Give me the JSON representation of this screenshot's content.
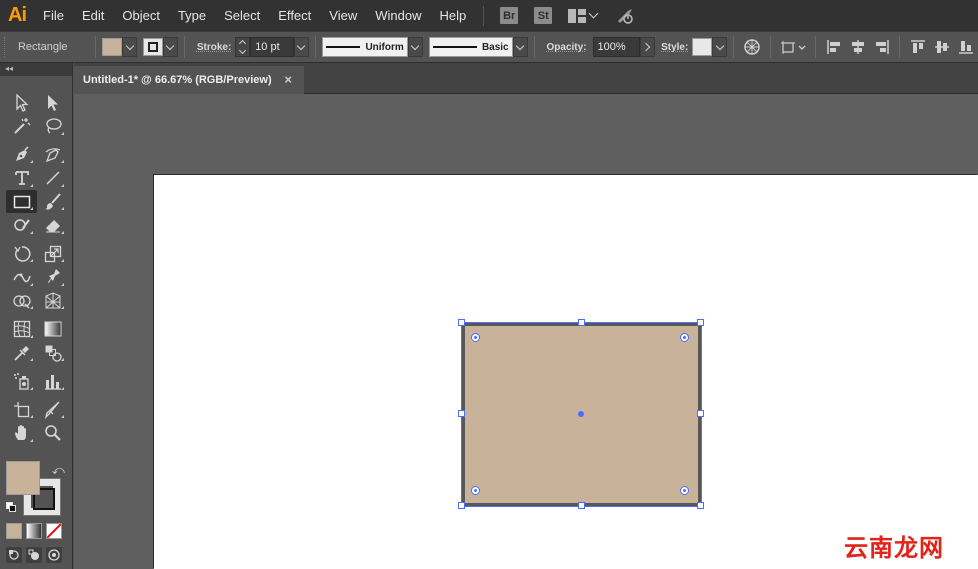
{
  "app": {
    "logo": "Ai",
    "accent": "#ff9a00"
  },
  "menu": {
    "items": [
      "File",
      "Edit",
      "Object",
      "Type",
      "Select",
      "Effect",
      "View",
      "Window",
      "Help"
    ],
    "bridge_label": "Br",
    "stock_label": "St",
    "workspace_icon": "workspace-grid-icon",
    "sync_icon": "gpu-rocket-icon"
  },
  "control": {
    "tool_name": "Rectangle",
    "fill_color": "#c8b29a",
    "stroke_label": "Stroke:",
    "stroke_weight": "10 pt",
    "variable_width_profile": "Uniform",
    "brush_definition": "Basic",
    "opacity_label": "Opacity:",
    "opacity_value": "100%",
    "style_label": "Style:"
  },
  "toolbar": {
    "collapse_label": "◂◂",
    "active_tool": "rectangle-tool",
    "fill_color": "#c8b29a",
    "stroke_color": "#e6e6e6"
  },
  "document": {
    "tab_title": "Untitled-1* @ 66.67% (RGB/Preview)",
    "close_label": "×"
  },
  "artwork": {
    "shape": "rectangle",
    "fill": "#c8b29a",
    "stroke": "#575757",
    "selection_color": "#4a6dff"
  },
  "watermark": {
    "text": "云南龙网",
    "color": "#e2231a"
  }
}
